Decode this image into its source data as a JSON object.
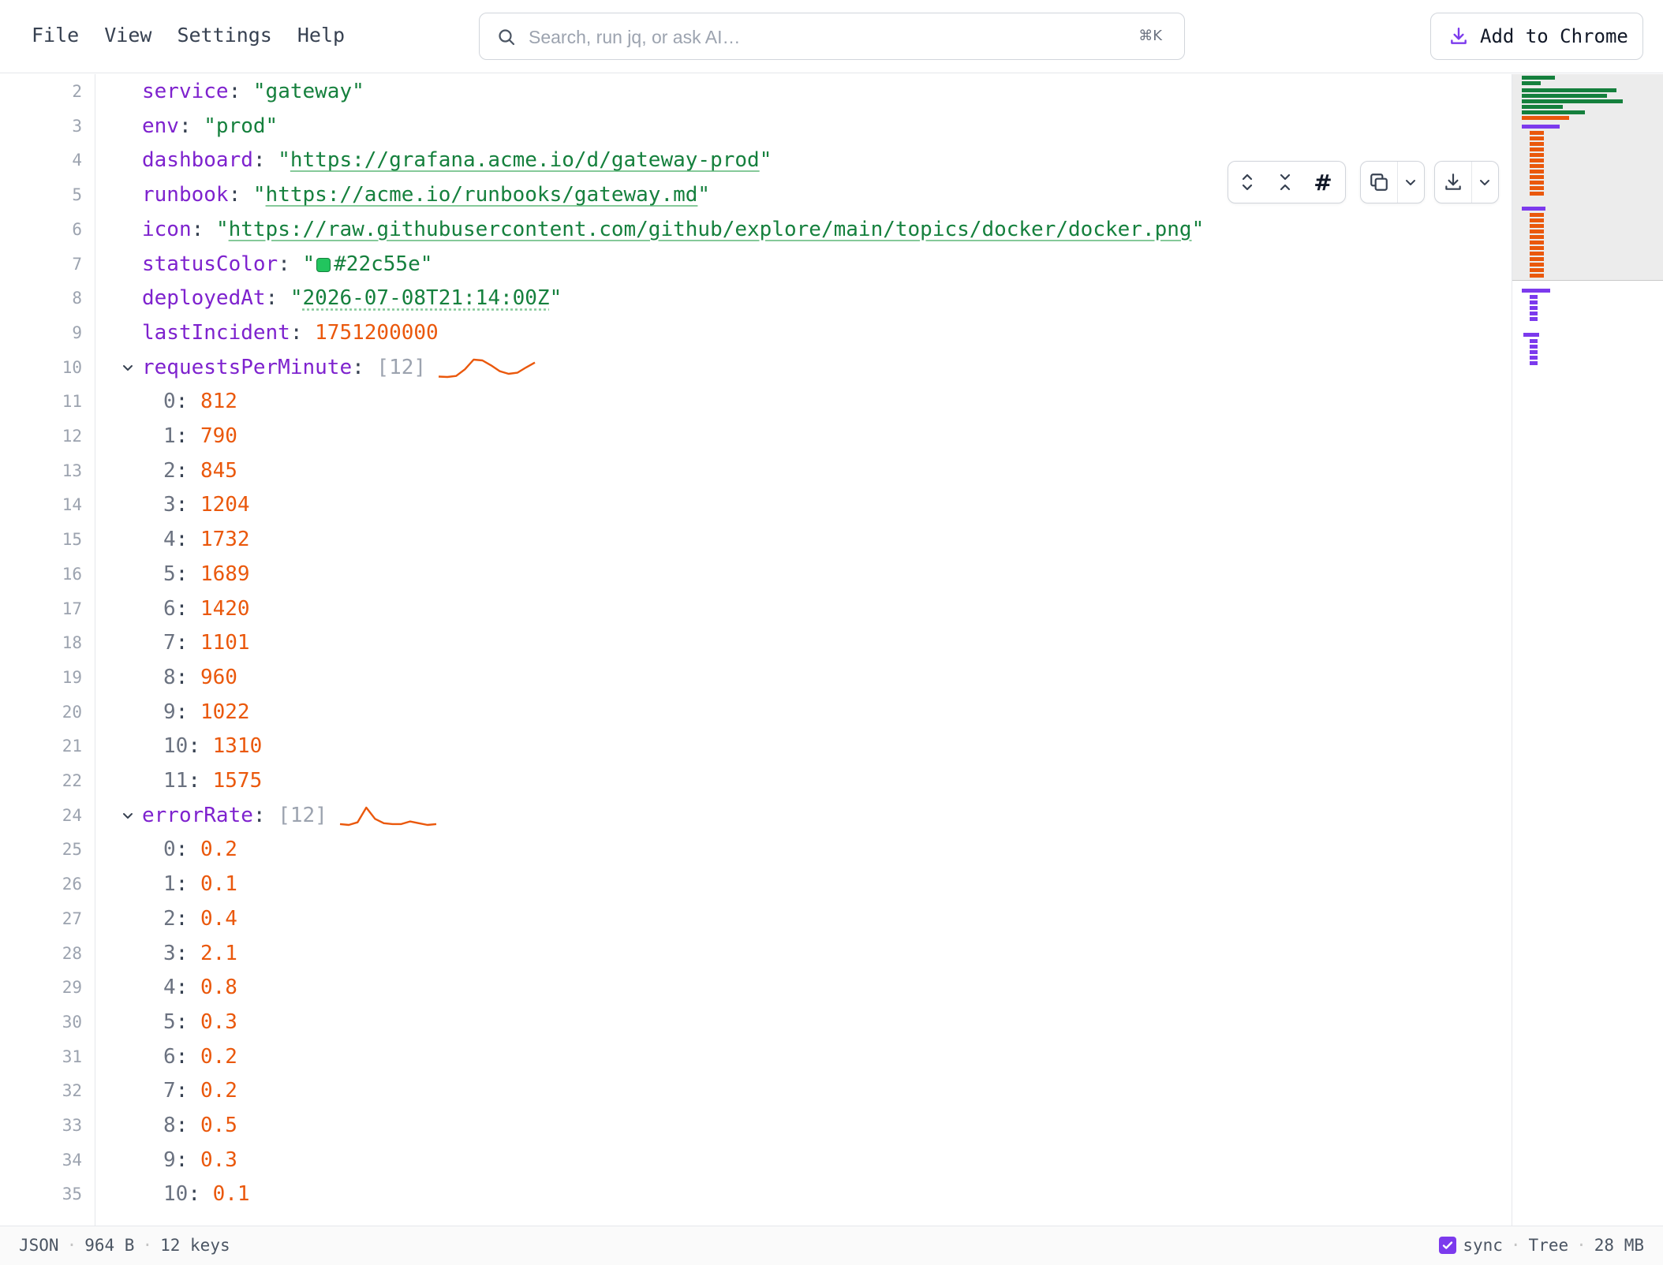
{
  "menu": {
    "file": "File",
    "view": "View",
    "settings": "Settings",
    "help": "Help"
  },
  "search": {
    "placeholder": "Search, run jq, or ask AI…",
    "shortcut": "⌘K"
  },
  "add_to_chrome": "Add to Chrome",
  "editor": {
    "lines": [
      {
        "n": "2",
        "key": "service",
        "str": "\"gateway\""
      },
      {
        "n": "3",
        "key": "env",
        "str": "\"prod\""
      },
      {
        "n": "4",
        "key": "dashboard",
        "url": "https://grafana.acme.io/d/gateway-prod"
      },
      {
        "n": "5",
        "key": "runbook",
        "url": "https://acme.io/runbooks/gateway.md"
      },
      {
        "n": "6",
        "key": "icon",
        "url": "https://raw.githubusercontent.com/github/explore/main/topics/docker/docker.png"
      },
      {
        "n": "7",
        "key": "statusColor",
        "color": "#22c55e"
      },
      {
        "n": "8",
        "key": "deployedAt",
        "date": "2026-07-08T21:14:00Z"
      },
      {
        "n": "9",
        "key": "lastIncident",
        "num": "1751200000"
      },
      {
        "n": "10",
        "key": "requestsPerMinute",
        "count": "[12]",
        "spark": [
          812,
          790,
          845,
          1204,
          1732,
          1689,
          1420,
          1101,
          960,
          1022,
          1310,
          1575
        ]
      },
      {
        "n": "11",
        "idx": "0",
        "num": "812"
      },
      {
        "n": "12",
        "idx": "1",
        "num": "790"
      },
      {
        "n": "13",
        "idx": "2",
        "num": "845"
      },
      {
        "n": "14",
        "idx": "3",
        "num": "1204"
      },
      {
        "n": "15",
        "idx": "4",
        "num": "1732"
      },
      {
        "n": "16",
        "idx": "5",
        "num": "1689"
      },
      {
        "n": "17",
        "idx": "6",
        "num": "1420"
      },
      {
        "n": "18",
        "idx": "7",
        "num": "1101"
      },
      {
        "n": "19",
        "idx": "8",
        "num": "960"
      },
      {
        "n": "20",
        "idx": "9",
        "num": "1022"
      },
      {
        "n": "21",
        "idx": "10",
        "num": "1310"
      },
      {
        "n": "22",
        "idx": "11",
        "num": "1575"
      },
      {
        "n": "24",
        "key": "errorRate",
        "count": "[12]",
        "spark": [
          0.2,
          0.1,
          0.4,
          2.1,
          0.8,
          0.3,
          0.2,
          0.2,
          0.5,
          0.3,
          0.1,
          0.2
        ]
      },
      {
        "n": "25",
        "idx": "0",
        "num": "0.2"
      },
      {
        "n": "26",
        "idx": "1",
        "num": "0.1"
      },
      {
        "n": "27",
        "idx": "2",
        "num": "0.4"
      },
      {
        "n": "28",
        "idx": "3",
        "num": "2.1"
      },
      {
        "n": "29",
        "idx": "4",
        "num": "0.8"
      },
      {
        "n": "30",
        "idx": "5",
        "num": "0.3"
      },
      {
        "n": "31",
        "idx": "6",
        "num": "0.2"
      },
      {
        "n": "32",
        "idx": "7",
        "num": "0.2"
      },
      {
        "n": "33",
        "idx": "8",
        "num": "0.5"
      },
      {
        "n": "34",
        "idx": "9",
        "num": "0.3"
      },
      {
        "n": "35",
        "idx": "10",
        "num": "0.1"
      }
    ]
  },
  "toolbar": {
    "icons": [
      "expand-all-icon",
      "collapse-all-icon",
      "line-numbers-icon",
      "copy-icon",
      "chevron-down-icon",
      "download-icon",
      "chevron-down-icon"
    ],
    "hash": "#"
  },
  "status": {
    "format": "JSON",
    "size": "964 B",
    "keys": "12 keys",
    "sync_label": "sync",
    "sync_checked": true,
    "view_mode": "Tree",
    "memory": "28 MB"
  },
  "colors": {
    "key": "#7e22ce",
    "string": "#15803d",
    "number": "#ea580c",
    "accent": "#7c3aed",
    "swatch": "#22c55e"
  }
}
